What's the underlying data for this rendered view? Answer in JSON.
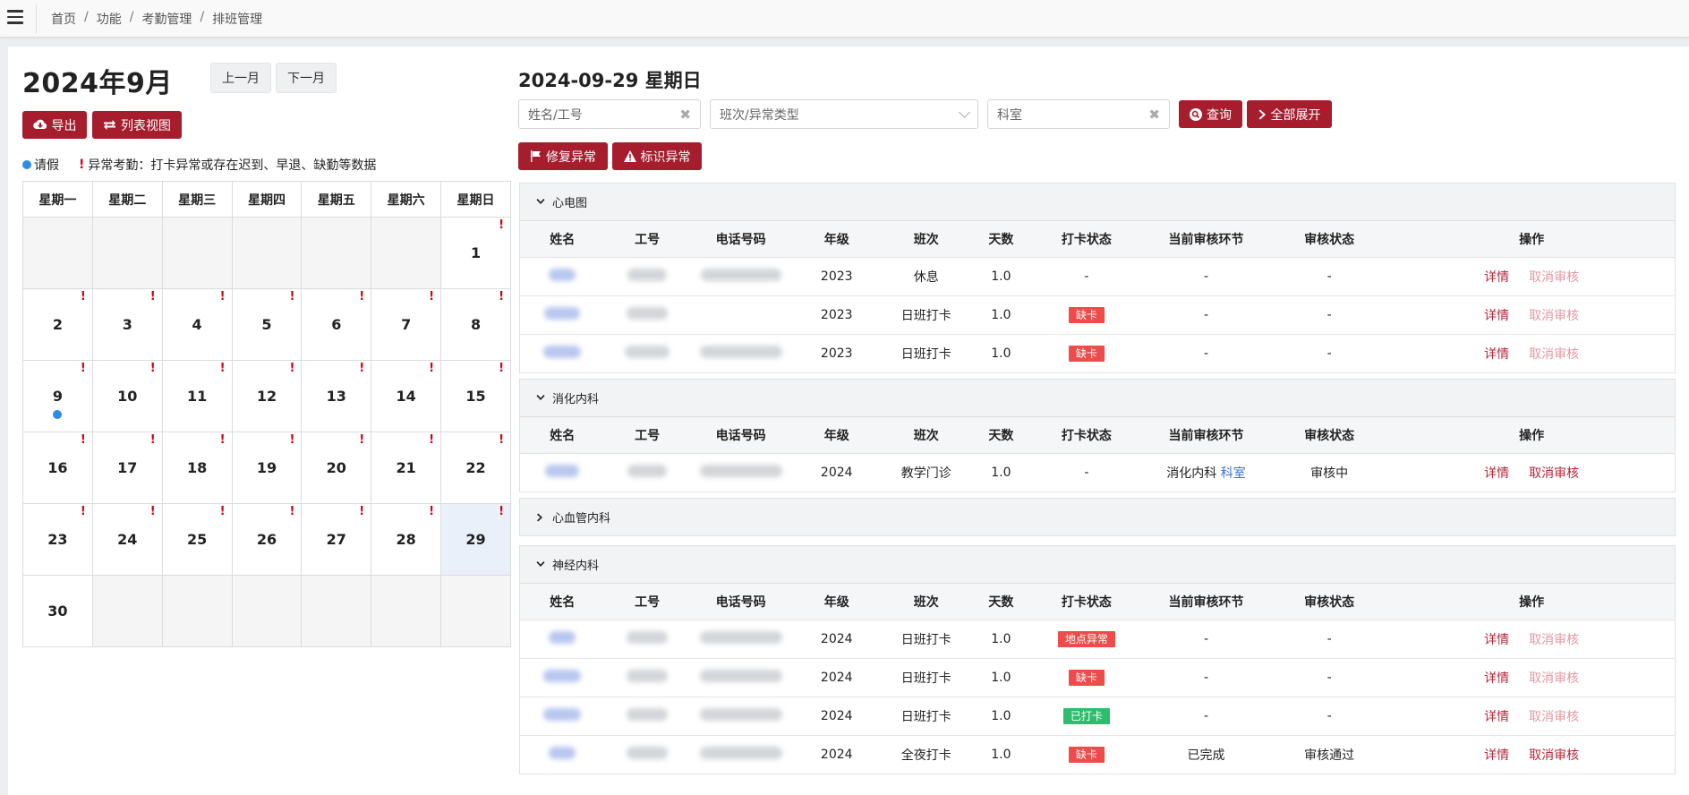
{
  "breadcrumb": [
    "首页",
    "功能",
    "考勤管理",
    "排班管理"
  ],
  "calendar": {
    "title": "2024年9月",
    "prev_label": "上一月",
    "next_label": "下一月",
    "export_label": "导出",
    "list_view_label": "列表视图",
    "legend_leave": "请假",
    "legend_abnormal": "异常考勤：打卡异常或存在迟到、早退、缺勤等数据",
    "weekdays": [
      "星期一",
      "星期二",
      "星期三",
      "星期四",
      "星期五",
      "星期六",
      "星期日"
    ],
    "weeks": [
      [
        {
          "d": ""
        },
        {
          "d": ""
        },
        {
          "d": ""
        },
        {
          "d": ""
        },
        {
          "d": ""
        },
        {
          "d": ""
        },
        {
          "d": "1",
          "mark": "!"
        }
      ],
      [
        {
          "d": "2",
          "mark": "!"
        },
        {
          "d": "3",
          "mark": "!"
        },
        {
          "d": "4",
          "mark": "!"
        },
        {
          "d": "5",
          "mark": "!"
        },
        {
          "d": "6",
          "mark": "!"
        },
        {
          "d": "7",
          "mark": "!"
        },
        {
          "d": "8",
          "mark": "!"
        }
      ],
      [
        {
          "d": "9",
          "mark": "!",
          "leave": true
        },
        {
          "d": "10",
          "mark": "!"
        },
        {
          "d": "11",
          "mark": "!"
        },
        {
          "d": "12",
          "mark": "!"
        },
        {
          "d": "13",
          "mark": "!"
        },
        {
          "d": "14",
          "mark": "!"
        },
        {
          "d": "15",
          "mark": "!"
        }
      ],
      [
        {
          "d": "16",
          "mark": "!"
        },
        {
          "d": "17",
          "mark": "!"
        },
        {
          "d": "18",
          "mark": "!"
        },
        {
          "d": "19",
          "mark": "!"
        },
        {
          "d": "20",
          "mark": "!"
        },
        {
          "d": "21",
          "mark": "!"
        },
        {
          "d": "22",
          "mark": "!"
        }
      ],
      [
        {
          "d": "23",
          "mark": "!"
        },
        {
          "d": "24",
          "mark": "!"
        },
        {
          "d": "25",
          "mark": "!"
        },
        {
          "d": "26",
          "mark": "!"
        },
        {
          "d": "27",
          "mark": "!"
        },
        {
          "d": "28",
          "mark": "!"
        },
        {
          "d": "29",
          "mark": "!",
          "selected": true
        }
      ],
      [
        {
          "d": "30"
        },
        {
          "d": ""
        },
        {
          "d": ""
        },
        {
          "d": ""
        },
        {
          "d": ""
        },
        {
          "d": ""
        },
        {
          "d": ""
        }
      ]
    ]
  },
  "detail": {
    "date_title": "2024-09-29 星期日",
    "filter_name_placeholder": "姓名/工号",
    "filter_shift_placeholder": "班次/异常类型",
    "filter_dept_value": "科室",
    "query_label": "查询",
    "expand_all_label": "全部展开",
    "repair_label": "修复异常",
    "mark_label": "标识异常",
    "columns": [
      "姓名",
      "工号",
      "电话号码",
      "年级",
      "班次",
      "天数",
      "打卡状态",
      "当前审核环节",
      "审核状态",
      "操作"
    ],
    "action_detail": "详情",
    "action_cancel": "取消审核",
    "groups": [
      {
        "name": "心电图",
        "expanded": true,
        "rows": [
          {
            "grade": "2023",
            "shift": "休息",
            "days": "1.0",
            "status": "-",
            "status_color": "",
            "stage": "-",
            "stage_link": "",
            "review": "-",
            "cancel_active": false,
            "nw": 30,
            "iw": 44,
            "pw": 90
          },
          {
            "grade": "2023",
            "shift": "日班打卡",
            "days": "1.0",
            "status": "缺卡",
            "status_color": "#ee4b4b",
            "stage": "-",
            "stage_link": "",
            "review": "-",
            "cancel_active": false,
            "nw": 40,
            "iw": 46,
            "pw": 0
          },
          {
            "grade": "2023",
            "shift": "日班打卡",
            "days": "1.0",
            "status": "缺卡",
            "status_color": "#ee4b4b",
            "stage": "-",
            "stage_link": "",
            "review": "-",
            "cancel_active": false,
            "nw": 42,
            "iw": 50,
            "pw": 92
          }
        ]
      },
      {
        "name": "消化内科",
        "expanded": true,
        "rows": [
          {
            "grade": "2024",
            "shift": "教学门诊",
            "days": "1.0",
            "status": "-",
            "status_color": "",
            "stage": "消化内科",
            "stage_link": "科室",
            "review": "审核中",
            "cancel_active": true,
            "nw": 38,
            "iw": 44,
            "pw": 92
          }
        ]
      },
      {
        "name": "心血管内科",
        "expanded": false,
        "rows": []
      },
      {
        "name": "神经内科",
        "expanded": true,
        "rows": [
          {
            "grade": "2024",
            "shift": "日班打卡",
            "days": "1.0",
            "status": "地点异常",
            "status_color": "#ee4b4b",
            "stage": "-",
            "stage_link": "",
            "review": "-",
            "cancel_active": false,
            "nw": 30,
            "iw": 46,
            "pw": 92
          },
          {
            "grade": "2024",
            "shift": "日班打卡",
            "days": "1.0",
            "status": "缺卡",
            "status_color": "#ee4b4b",
            "stage": "-",
            "stage_link": "",
            "review": "-",
            "cancel_active": false,
            "nw": 42,
            "iw": 46,
            "pw": 92
          },
          {
            "grade": "2024",
            "shift": "日班打卡",
            "days": "1.0",
            "status": "已打卡",
            "status_color": "#2dbd6e",
            "stage": "-",
            "stage_link": "",
            "review": "-",
            "cancel_active": false,
            "nw": 42,
            "iw": 46,
            "pw": 92
          },
          {
            "grade": "2024",
            "shift": "全夜打卡",
            "days": "1.0",
            "status": "缺卡",
            "status_color": "#ee4b4b",
            "stage": "已完成",
            "stage_link": "",
            "review": "审核通过",
            "cancel_active": true,
            "nw": 30,
            "iw": 46,
            "pw": 92
          }
        ]
      }
    ]
  }
}
